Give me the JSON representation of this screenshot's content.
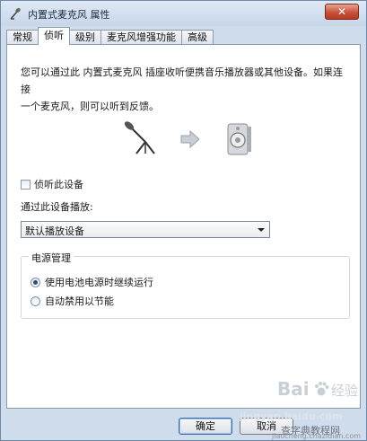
{
  "window": {
    "title": "内置式麦克风 属性",
    "close_glyph": "✕"
  },
  "tabs": [
    {
      "label": "常规",
      "active": false
    },
    {
      "label": "侦听",
      "active": true
    },
    {
      "label": "级别",
      "active": false
    },
    {
      "label": "麦克风增强功能",
      "active": false
    },
    {
      "label": "高级",
      "active": false
    }
  ],
  "listen": {
    "description_line1": "您可以通过此 内置式麦克风 插座收听便携音乐播放器或其他设备。如果连接",
    "description_line2": "一个麦克风，则可以听到反馈。",
    "illustration_icons": [
      "microphone-icon",
      "arrow-right-icon",
      "speaker-icon"
    ],
    "listen_checkbox_label": "侦听此设备",
    "listen_checked": false,
    "playthrough_label": "通过此设备播放:",
    "playthrough_selected": "默认播放设备"
  },
  "power": {
    "group_title": "电源管理",
    "option_continue": "使用电池电源时继续运行",
    "option_disable": "自动禁用以节能",
    "selected": "option_continue"
  },
  "buttons": {
    "ok": "确定",
    "cancel": "取消"
  },
  "watermark": {
    "brand": "Bai",
    "brand_tail": "经验",
    "url": "jingyan.baidu.com",
    "site": "查字典教程网",
    "site_url": "jiaocheng.chazidian.com"
  },
  "colors": {
    "window_frame": "#cfdceb",
    "close_button": "#c8523b",
    "panel": "#ffffff",
    "radio_dot": "#2a4f7a"
  }
}
